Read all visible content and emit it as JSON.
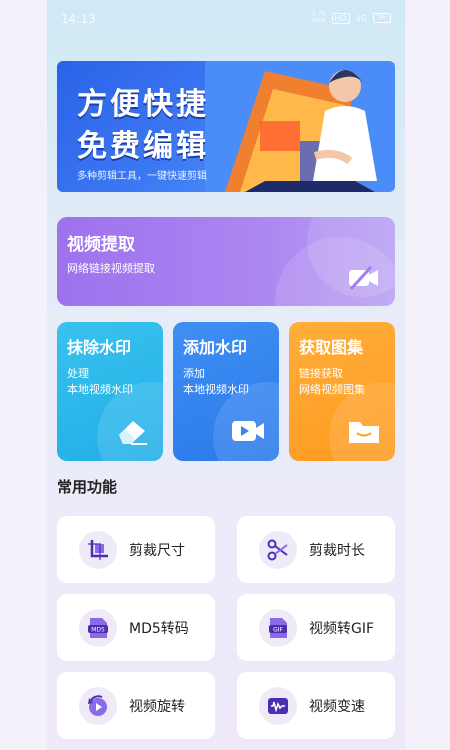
{
  "status": {
    "time": "14:13",
    "net": "HD",
    "speed": "5.70\nKB/s",
    "signal": "4G",
    "battery": "96"
  },
  "banner": {
    "title_line1": "方便快捷",
    "title_line2": "免费编辑",
    "subtitle": "多种剪辑工具，一键快速剪辑"
  },
  "extract": {
    "title": "视频提取",
    "desc": "网络链接视频提取",
    "icon": "video-off-icon"
  },
  "tiles": [
    {
      "title": "抹除水印",
      "desc_line1": "处理",
      "desc_line2": "本地视频水印",
      "icon": "eraser-icon",
      "color": "#2ab6ea"
    },
    {
      "title": "添加水印",
      "desc_line1": "添加",
      "desc_line2": "本地视频水印",
      "icon": "video-camera-icon",
      "color": "#3385ef"
    },
    {
      "title": "获取图集",
      "desc_line1": "链接获取",
      "desc_line2": "网络视频图集",
      "icon": "folder-icon",
      "color": "#ffa22a"
    }
  ],
  "section": {
    "common_title": "常用功能"
  },
  "functions": [
    {
      "label": "剪裁尺寸",
      "icon": "crop-icon"
    },
    {
      "label": "剪裁时长",
      "icon": "scissors-icon"
    },
    {
      "label": "MD5转码",
      "icon": "md5-file-icon"
    },
    {
      "label": "视频转GIF",
      "icon": "gif-file-icon"
    },
    {
      "label": "视频旋转",
      "icon": "rotate-play-icon"
    },
    {
      "label": "视频变速",
      "icon": "waveform-icon"
    }
  ],
  "colors": {
    "accent": "#7b5be0",
    "purple_card": "#a57bf0",
    "icon_bg": "#eeeaf8"
  }
}
